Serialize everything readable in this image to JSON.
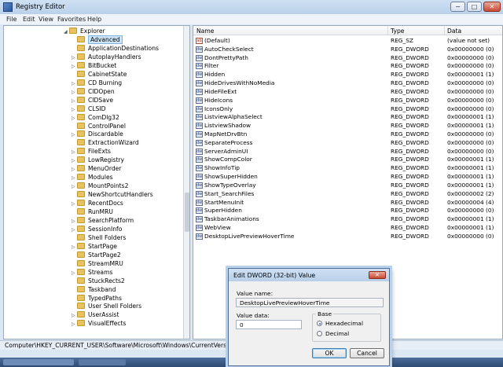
{
  "window": {
    "title": "Registry Editor",
    "controls": {
      "minimize": "−",
      "maximize": "□",
      "close": "✕"
    }
  },
  "menu": [
    "File",
    "Edit",
    "View",
    "Favorites",
    "Help"
  ],
  "tree": {
    "parent": "Explorer",
    "items": [
      {
        "label": "Advanced",
        "selected": true,
        "expandable": false
      },
      {
        "label": "ApplicationDestinations",
        "expandable": false
      },
      {
        "label": "AutoplayHandlers",
        "expandable": true
      },
      {
        "label": "BitBucket",
        "expandable": true
      },
      {
        "label": "CabinetState",
        "expandable": false
      },
      {
        "label": "CD Burning",
        "expandable": true
      },
      {
        "label": "CIDOpen",
        "expandable": true
      },
      {
        "label": "CIDSave",
        "expandable": true
      },
      {
        "label": "CLSID",
        "expandable": true
      },
      {
        "label": "ComDlg32",
        "expandable": true
      },
      {
        "label": "ControlPanel",
        "expandable": false
      },
      {
        "label": "Discardable",
        "expandable": true
      },
      {
        "label": "ExtractionWizard",
        "expandable": false
      },
      {
        "label": "FileExts",
        "expandable": true
      },
      {
        "label": "LowRegistry",
        "expandable": true
      },
      {
        "label": "MenuOrder",
        "expandable": true
      },
      {
        "label": "Modules",
        "expandable": true
      },
      {
        "label": "MountPoints2",
        "expandable": true
      },
      {
        "label": "NewShortcutHandlers",
        "expandable": false
      },
      {
        "label": "RecentDocs",
        "expandable": true
      },
      {
        "label": "RunMRU",
        "expandable": false
      },
      {
        "label": "SearchPlatform",
        "expandable": true
      },
      {
        "label": "SessionInfo",
        "expandable": true
      },
      {
        "label": "Shell Folders",
        "expandable": false
      },
      {
        "label": "StartPage",
        "expandable": true
      },
      {
        "label": "StartPage2",
        "expandable": false
      },
      {
        "label": "StreamMRU",
        "expandable": false
      },
      {
        "label": "Streams",
        "expandable": true
      },
      {
        "label": "StuckRects2",
        "expandable": false
      },
      {
        "label": "Taskband",
        "expandable": false
      },
      {
        "label": "TypedPaths",
        "expandable": false
      },
      {
        "label": "User Shell Folders",
        "expandable": false
      },
      {
        "label": "UserAssist",
        "expandable": true
      },
      {
        "label": "VisualEffects",
        "expandable": true
      }
    ]
  },
  "list": {
    "headers": {
      "name": "Name",
      "type": "Type",
      "data": "Data"
    },
    "rows": [
      {
        "icon": "ab",
        "name": "(Default)",
        "type": "REG_SZ",
        "data": "(value not set)"
      },
      {
        "icon": "dw",
        "name": "AutoCheckSelect",
        "type": "REG_DWORD",
        "data": "0x00000000 (0)"
      },
      {
        "icon": "dw",
        "name": "DontPrettyPath",
        "type": "REG_DWORD",
        "data": "0x00000000 (0)"
      },
      {
        "icon": "dw",
        "name": "Filter",
        "type": "REG_DWORD",
        "data": "0x00000000 (0)"
      },
      {
        "icon": "dw",
        "name": "Hidden",
        "type": "REG_DWORD",
        "data": "0x00000001 (1)"
      },
      {
        "icon": "dw",
        "name": "HideDrivesWithNoMedia",
        "type": "REG_DWORD",
        "data": "0x00000000 (0)"
      },
      {
        "icon": "dw",
        "name": "HideFileExt",
        "type": "REG_DWORD",
        "data": "0x00000000 (0)"
      },
      {
        "icon": "dw",
        "name": "HideIcons",
        "type": "REG_DWORD",
        "data": "0x00000000 (0)"
      },
      {
        "icon": "dw",
        "name": "IconsOnly",
        "type": "REG_DWORD",
        "data": "0x00000000 (0)"
      },
      {
        "icon": "dw",
        "name": "ListviewAlphaSelect",
        "type": "REG_DWORD",
        "data": "0x00000001 (1)"
      },
      {
        "icon": "dw",
        "name": "ListviewShadow",
        "type": "REG_DWORD",
        "data": "0x00000001 (1)"
      },
      {
        "icon": "dw",
        "name": "MapNetDrvBtn",
        "type": "REG_DWORD",
        "data": "0x00000000 (0)"
      },
      {
        "icon": "dw",
        "name": "SeparateProcess",
        "type": "REG_DWORD",
        "data": "0x00000000 (0)"
      },
      {
        "icon": "dw",
        "name": "ServerAdminUI",
        "type": "REG_DWORD",
        "data": "0x00000000 (0)"
      },
      {
        "icon": "dw",
        "name": "ShowCompColor",
        "type": "REG_DWORD",
        "data": "0x00000001 (1)"
      },
      {
        "icon": "dw",
        "name": "ShowInfoTip",
        "type": "REG_DWORD",
        "data": "0x00000001 (1)"
      },
      {
        "icon": "dw",
        "name": "ShowSuperHidden",
        "type": "REG_DWORD",
        "data": "0x00000001 (1)"
      },
      {
        "icon": "dw",
        "name": "ShowTypeOverlay",
        "type": "REG_DWORD",
        "data": "0x00000001 (1)"
      },
      {
        "icon": "dw",
        "name": "Start_SearchFiles",
        "type": "REG_DWORD",
        "data": "0x00000002 (2)"
      },
      {
        "icon": "dw",
        "name": "StartMenuInit",
        "type": "REG_DWORD",
        "data": "0x00000004 (4)"
      },
      {
        "icon": "dw",
        "name": "SuperHidden",
        "type": "REG_DWORD",
        "data": "0x00000000 (0)"
      },
      {
        "icon": "dw",
        "name": "TaskbarAnimations",
        "type": "REG_DWORD",
        "data": "0x00000001 (1)"
      },
      {
        "icon": "dw",
        "name": "WebView",
        "type": "REG_DWORD",
        "data": "0x00000001 (1)"
      },
      {
        "icon": "dw",
        "name": "DesktopLivePreviewHoverTime",
        "type": "REG_DWORD",
        "data": "0x00000000 (0)"
      }
    ]
  },
  "status": {
    "path": "Computer\\HKEY_CURRENT_USER\\Software\\Microsoft\\Windows\\CurrentVersion\\Explore"
  },
  "dialog": {
    "title": "Edit DWORD (32-bit) Value",
    "close": "✕",
    "value_name_label": "Value name:",
    "value_name": "DesktopLivePreviewHoverTime",
    "value_data_label": "Value data:",
    "value_data": "0",
    "base_label": "Base",
    "base_options": [
      {
        "label": "Hexadecimal",
        "selected": true
      },
      {
        "label": "Decimal",
        "selected": false
      }
    ],
    "ok_label": "OK",
    "cancel_label": "Cancel"
  }
}
